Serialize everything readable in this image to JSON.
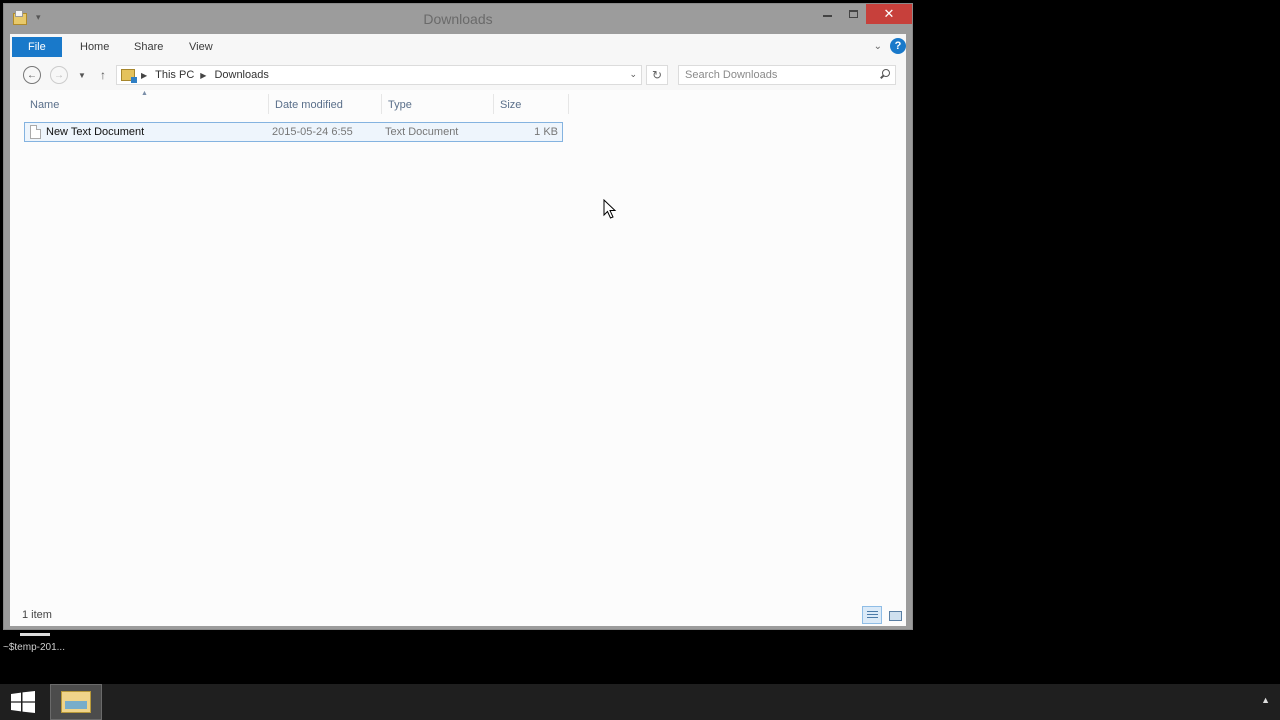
{
  "window": {
    "title": "Downloads",
    "close_glyph": "✕"
  },
  "ribbon": {
    "tabs": [
      {
        "label": "File"
      },
      {
        "label": "Home"
      },
      {
        "label": "Share"
      },
      {
        "label": "View"
      }
    ],
    "help_glyph": "?"
  },
  "address": {
    "breadcrumbs": [
      "This PC",
      "Downloads"
    ],
    "search_placeholder": "Search Downloads"
  },
  "columns": [
    "Name",
    "Date modified",
    "Type",
    "Size"
  ],
  "files": [
    {
      "name": "New Text Document",
      "date_modified": "2015-05-24 6:55",
      "type": "Text Document",
      "size": "1 KB"
    }
  ],
  "status": {
    "item_count": "1 item"
  },
  "desktop": {
    "label": "~$temp-201..."
  },
  "colors": {
    "file_tab": "#1979ca",
    "close_button": "#c7403b",
    "selection_border": "#84b3e0",
    "taskbar": "#1f1f1f"
  },
  "icons": [
    "folder-icon",
    "back-arrow-icon",
    "forward-arrow-icon",
    "recent-dropdown-icon",
    "up-arrow-icon",
    "refresh-icon",
    "search-icon",
    "help-icon",
    "text-file-icon",
    "details-view-icon",
    "thumbnail-view-icon",
    "windows-start-icon",
    "file-explorer-icon"
  ]
}
